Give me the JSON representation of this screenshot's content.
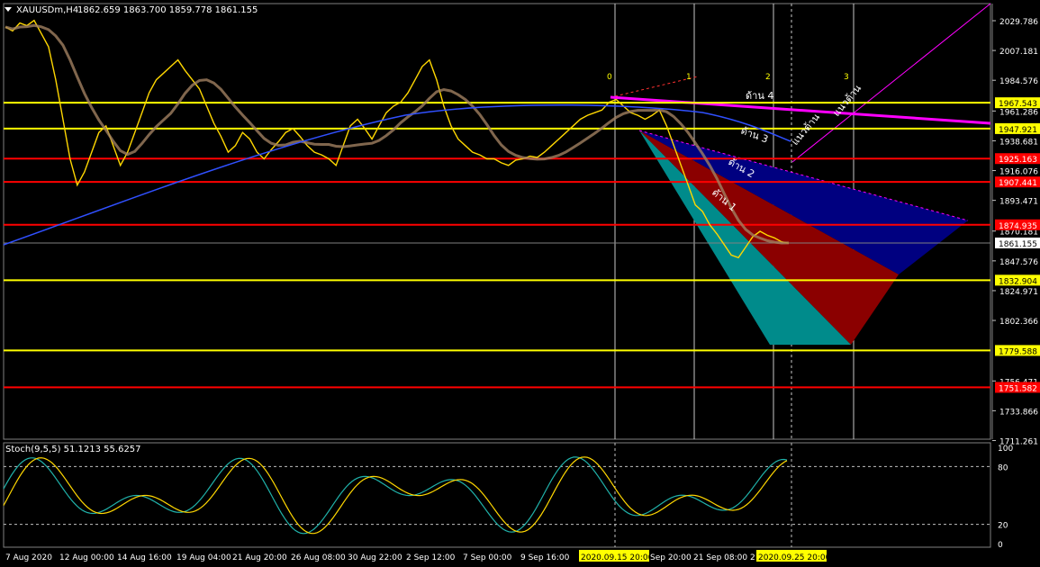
{
  "header": {
    "symbol_info": "XAUUSDm,H4",
    "ohlc": "1862.659 1863.700 1859.778 1861.155"
  },
  "indicator": {
    "label": "Stoch(9,5,5) 51.1213 55.6257",
    "levels": [
      "100",
      "80",
      "20",
      "0"
    ]
  },
  "chart_data": {
    "type": "line",
    "symbol": "XAUUSDm",
    "timeframe": "H4",
    "ylim": [
      1711.261,
      2040
    ],
    "y_ticks": [
      "2029.786",
      "2007.181",
      "1984.576",
      "1961.286",
      "1938.681",
      "1916.076",
      "1893.471",
      "1870.181",
      "1847.576",
      "1824.971",
      "1802.366",
      "1756.471",
      "1733.866",
      "1711.261"
    ],
    "x_ticks": [
      "7 Aug 2020",
      "12 Aug 00:00",
      "14 Aug 16:00",
      "19 Aug 04:00",
      "21 Aug 20:00",
      "26 Aug 08:00",
      "30 Aug 22:00",
      "2 Sep 12:00",
      "7 Sep 00:00",
      "9 Sep 16:00",
      "2020.09.15 20:00",
      "Sep 20:00",
      "21 Sep 08:00",
      "2",
      "2020.09.25 20:00"
    ],
    "price_levels": [
      {
        "value": 1967.543,
        "label": "1967.543",
        "color": "#ffff00"
      },
      {
        "value": 1947.921,
        "label": "1947.921",
        "color": "#ffff00"
      },
      {
        "value": 1925.163,
        "label": "1925.163",
        "color": "#ff0000"
      },
      {
        "value": 1907.441,
        "label": "1907.441",
        "color": "#ff0000"
      },
      {
        "value": 1874.935,
        "label": "1874.935",
        "color": "#ff0000"
      },
      {
        "value": 1832.904,
        "label": "1832.904",
        "color": "#ffff00"
      },
      {
        "value": 1779.588,
        "label": "1779.588",
        "color": "#ffff00"
      },
      {
        "value": 1751.582,
        "label": "1751.582",
        "color": "#ff0000"
      }
    ],
    "current_price": {
      "value": 1861.155,
      "label": "1861.155"
    },
    "fib_time_labels": [
      "0",
      "1",
      "2",
      "3"
    ],
    "annotations": [
      "ด้าน 4",
      "ด้าน 3",
      "ด้าน 2",
      "ด้าน 1",
      "แนวต้าน",
      "แนวต้าน"
    ],
    "close_prices": [
      2025,
      2022,
      2028,
      2026,
      2030,
      2020,
      2010,
      1985,
      1955,
      1925,
      1905,
      1915,
      1930,
      1945,
      1950,
      1935,
      1920,
      1930,
      1945,
      1960,
      1975,
      1985,
      1990,
      1995,
      2000,
      1992,
      1985,
      1978,
      1965,
      1952,
      1942,
      1930,
      1935,
      1945,
      1940,
      1930,
      1925,
      1932,
      1938,
      1945,
      1948,
      1942,
      1935,
      1930,
      1928,
      1925,
      1920,
      1935,
      1950,
      1955,
      1948,
      1940,
      1950,
      1960,
      1965,
      1968,
      1975,
      1985,
      1995,
      2000,
      1985,
      1965,
      1950,
      1940,
      1935,
      1930,
      1928,
      1925,
      1925,
      1922,
      1920,
      1924,
      1925,
      1927,
      1926,
      1930,
      1935,
      1940,
      1945,
      1950,
      1955,
      1958,
      1960,
      1962,
      1968,
      1970,
      1965,
      1960,
      1958,
      1955,
      1958,
      1962,
      1950,
      1935,
      1920,
      1905,
      1890,
      1885,
      1875,
      1868,
      1860,
      1852,
      1850,
      1858,
      1866,
      1870,
      1867,
      1865,
      1862,
      1861
    ]
  }
}
